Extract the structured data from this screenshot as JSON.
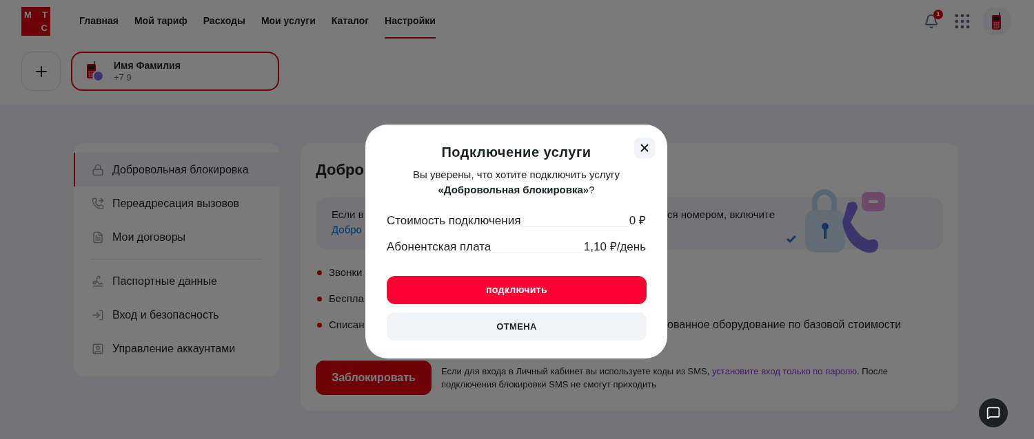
{
  "header": {
    "logo": [
      "М",
      "Т",
      "С"
    ],
    "nav": [
      {
        "label": "Главная",
        "selected": false
      },
      {
        "label": "Мой тариф",
        "selected": false
      },
      {
        "label": "Расходы",
        "selected": false
      },
      {
        "label": "Мои услуги",
        "selected": false
      },
      {
        "label": "Каталог",
        "selected": false
      },
      {
        "label": "Настройки",
        "selected": true
      }
    ],
    "notifications": "1"
  },
  "account": {
    "name": "Имя Фамилия",
    "phone": "+7 9",
    "selected": true
  },
  "sidebar": {
    "groups": [
      [
        {
          "label": "Добровольная блокировка",
          "selected": true
        },
        {
          "label": "Переадресация вызовов",
          "selected": false
        },
        {
          "label": "Мои договоры",
          "selected": false
        }
      ],
      [
        {
          "label": "Паспортные данные",
          "selected": false
        },
        {
          "label": "Вход и безопасность",
          "selected": false
        },
        {
          "label": "Управление аккаунтами",
          "selected": false
        }
      ]
    ]
  },
  "content": {
    "title": "Добро",
    "info_text": "Если в",
    "info_link": "Добро",
    "info_text_right": "ся номером, включите",
    "bullets": [
      {
        "left": "Звонки"
      },
      {
        "left": "Беспла"
      },
      {
        "left": "Списан",
        "right": "ованное оборудование по базовой стоимости"
      }
    ],
    "button": "Заблокировать",
    "note_start": "Если для входа в Личный кабинет вы используете коды из SMS, ",
    "note_link": "установите вход только по паролю",
    "note_end": ". После подключения блокировки SMS не смогут приходить"
  },
  "dialog": {
    "title": "Подключение услуги",
    "message": "Вы уверены, что хотите подключить услугу **«Добровольная блокировка»**?",
    "rows": [
      {
        "label": "Стоимость подключения",
        "value": "0 ₽"
      },
      {
        "label": "Абонентская плата",
        "value": "1,10 ₽/день"
      }
    ],
    "confirm": "подключить",
    "cancel": "ОТМЕНА"
  }
}
